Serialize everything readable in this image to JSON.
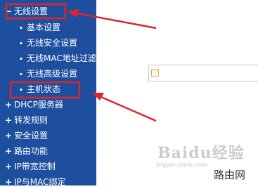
{
  "sidebar": {
    "items": [
      {
        "mark": "−",
        "label": "无线设置",
        "kind": "section"
      },
      {
        "mark": "•",
        "label": "基本设置",
        "kind": "sub"
      },
      {
        "mark": "•",
        "label": "无线安全设置",
        "kind": "sub"
      },
      {
        "mark": "•",
        "label": "无线MAC地址过滤",
        "kind": "sub"
      },
      {
        "mark": "•",
        "label": "无线高级设置",
        "kind": "sub"
      },
      {
        "mark": "•",
        "label": "主机状态",
        "kind": "sub"
      },
      {
        "mark": "+",
        "label": "DHCP服务器",
        "kind": "section"
      },
      {
        "mark": "+",
        "label": "转发规则",
        "kind": "section"
      },
      {
        "mark": "+",
        "label": "安全设置",
        "kind": "section"
      },
      {
        "mark": "+",
        "label": "路由功能",
        "kind": "section"
      },
      {
        "mark": "+",
        "label": "IP带宽控制",
        "kind": "section"
      },
      {
        "mark": "+",
        "label": "IP与MAC绑定",
        "kind": "section"
      }
    ]
  },
  "watermark": {
    "brand": "Baidu经验",
    "url": "jingyan.baidu.com",
    "router_label": "路由网"
  },
  "colors": {
    "sidebar_bg": "#1d4f9e",
    "highlight": "#e0242b",
    "text": "#ffffff"
  }
}
